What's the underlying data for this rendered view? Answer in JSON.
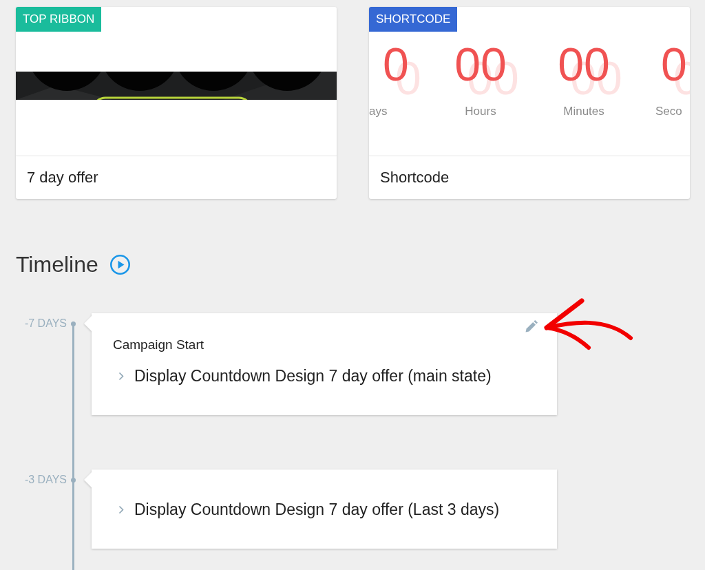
{
  "templates": [
    {
      "kind": "image",
      "badge": "TOP RIBBON",
      "color": "#1abc9c",
      "name": "7 day offer"
    },
    {
      "kind": "countdown",
      "badge": "SHORTCODE",
      "color": "#3568d4",
      "countdown": [
        {
          "digits": "0",
          "label": "ays"
        },
        {
          "digits": "00",
          "label": "Hours"
        },
        {
          "digits": "00",
          "label": "Minutes"
        },
        {
          "digits": "0",
          "label": "Seco"
        }
      ],
      "name": "Shortcode"
    }
  ],
  "timeline": {
    "title": "Timeline",
    "events": [
      {
        "offset": "-7 DAYS",
        "title": "Campaign Start",
        "editable": true,
        "actions": [
          {
            "text": "Display Countdown Design 7 day offer (main state)",
            "expanded": false
          }
        ]
      },
      {
        "offset": "-3 DAYS",
        "editable": false,
        "actions": [
          {
            "text": "Display Countdown Design 7 day offer (Last 3 days)",
            "expanded": false
          }
        ]
      }
    ]
  }
}
